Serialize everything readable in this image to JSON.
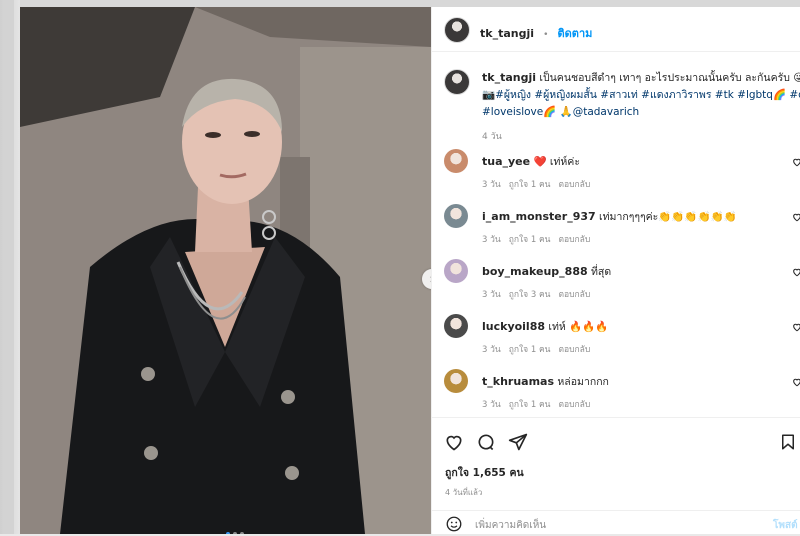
{
  "post": {
    "username": "tk_tangji",
    "separator": "•",
    "follow_label": "ติดตาม",
    "caption_user": "tk_tangji",
    "caption_text": "เป็นคนชอบสีดำๆ เทาๆ อะไรประมาณนั้นครับ ละกันครับ 😜",
    "caption_line2_prefix": "📷",
    "caption_line2_tags": "#ผู้หญิง #ผู้หญิงผมสั้น #สาวเท่ #แดงภาวิราพร #tk #lgbtq🌈 #q",
    "caption_line3_tags": "#loveislove🌈",
    "caption_line3_rest": " 🙏@tadavarich",
    "caption_time": "4 วัน"
  },
  "comments": [
    {
      "user": "tua_yee",
      "text": "❤️ เท่ห์ค่ะ",
      "time": "3 วัน",
      "likes": "ถูกใจ 1 คน",
      "reply": "ตอบกลับ",
      "avatar_color": "#c98b6b"
    },
    {
      "user": "i_am_monster_937",
      "text": "เท่มากๆๆๆค่ะ👏👏👏👏👏👏",
      "time": "3 วัน",
      "likes": "ถูกใจ 1 คน",
      "reply": "ตอบกลับ",
      "avatar_color": "#7a8a92"
    },
    {
      "user": "boy_makeup_888",
      "text": "ที่สุด",
      "time": "3 วัน",
      "likes": "ถูกใจ 3 คน",
      "reply": "ตอบกลับ",
      "avatar_color": "#b9a6c7"
    },
    {
      "user": "luckyoil88",
      "text": "เท่ห์ 🔥🔥🔥",
      "time": "3 วัน",
      "likes": "ถูกใจ 1 คน",
      "reply": "ตอบกลับ",
      "avatar_color": "#4a4a4a"
    },
    {
      "user": "t_khruamas",
      "text": "หล่อมากกก",
      "time": "3 วัน",
      "likes": "ถูกใจ 1 คน",
      "reply": "ตอบกลับ",
      "avatar_color": "#b88c3c"
    }
  ],
  "footer": {
    "likes_label": "ถูกใจ 1,655 คน",
    "posted_when": "4 วันที่แล้ว",
    "comment_placeholder": "เพิ่มความคิดเห็น",
    "post_label": "โพสต์"
  },
  "icons": {
    "heart": "heart-icon",
    "comment": "comment-icon",
    "share": "share-icon",
    "save": "bookmark-icon",
    "emoji": "emoji-icon",
    "next": "chevron-right-icon"
  },
  "colors": {
    "accent": "#0095f6",
    "hashtag": "#00376b",
    "muted": "#8e8e8e",
    "carousel_active": "#3897f0"
  }
}
